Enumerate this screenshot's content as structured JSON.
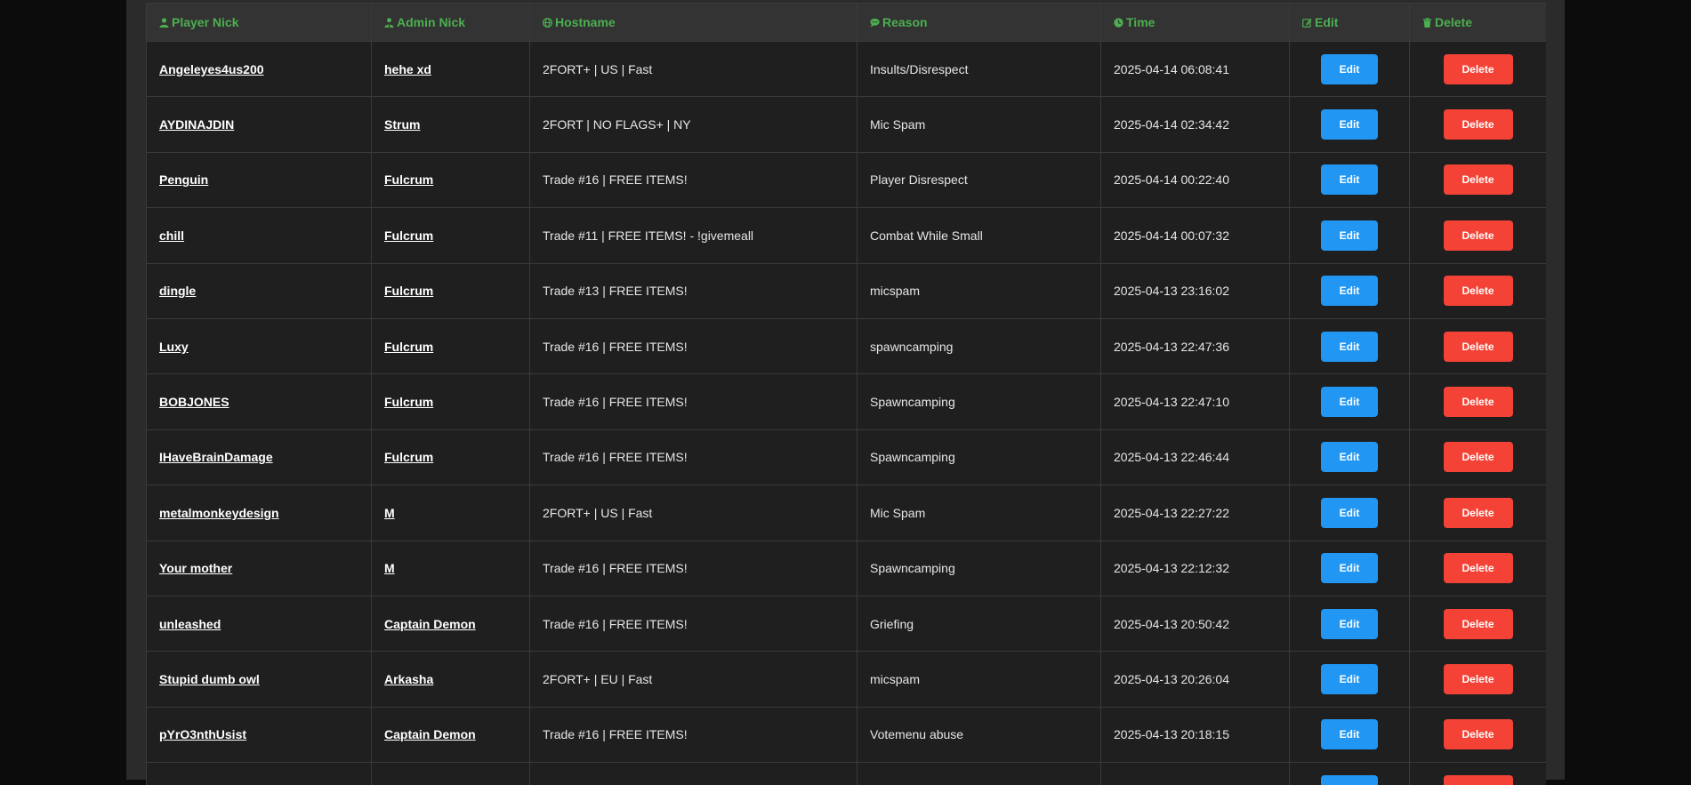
{
  "colors": {
    "header_text": "#4caf50",
    "edit": "#2196f3",
    "delete": "#f44336"
  },
  "headers": {
    "player": {
      "label": "Player Nick",
      "icon": "user-icon"
    },
    "admin": {
      "label": "Admin Nick",
      "icon": "user-tie-icon"
    },
    "hostname": {
      "label": "Hostname",
      "icon": "globe-icon"
    },
    "reason": {
      "label": "Reason",
      "icon": "comment-icon"
    },
    "time": {
      "label": "Time",
      "icon": "clock-icon"
    },
    "edit": {
      "label": "Edit",
      "icon": "edit-icon"
    },
    "delete": {
      "label": "Delete",
      "icon": "trash-icon"
    }
  },
  "rows": [
    {
      "player": "Angeleyes4us200",
      "admin": "hehe xd",
      "hostname": "2FORT+ | US | Fast",
      "reason": "Insults/Disrespect",
      "time": "2025-04-14 06:08:41",
      "edit": "Edit",
      "delete": "Delete"
    },
    {
      "player": "AYDINAJDIN",
      "admin": "Strum",
      "hostname": "2FORT | NO FLAGS+ | NY",
      "reason": "Mic Spam",
      "time": "2025-04-14 02:34:42",
      "edit": "Edit",
      "delete": "Delete"
    },
    {
      "player": "Penguin",
      "admin": "Fulcrum",
      "hostname": "Trade #16 | FREE ITEMS!",
      "reason": "Player Disrespect",
      "time": "2025-04-14 00:22:40",
      "edit": "Edit",
      "delete": "Delete"
    },
    {
      "player": "chill",
      "admin": "Fulcrum",
      "hostname": "Trade #11 | FREE ITEMS! - !givemeall",
      "reason": "Combat While Small",
      "time": "2025-04-14 00:07:32",
      "edit": "Edit",
      "delete": "Delete"
    },
    {
      "player": "dingle",
      "admin": "Fulcrum",
      "hostname": "Trade #13 | FREE ITEMS!",
      "reason": "micspam",
      "time": "2025-04-13 23:16:02",
      "edit": "Edit",
      "delete": "Delete"
    },
    {
      "player": "Luxy",
      "admin": "Fulcrum",
      "hostname": "Trade #16 | FREE ITEMS!",
      "reason": "spawncamping",
      "time": "2025-04-13 22:47:36",
      "edit": "Edit",
      "delete": "Delete"
    },
    {
      "player": "BOBJONES",
      "admin": "Fulcrum",
      "hostname": "Trade #16 | FREE ITEMS!",
      "reason": "Spawncamping",
      "time": "2025-04-13 22:47:10",
      "edit": "Edit",
      "delete": "Delete"
    },
    {
      "player": "IHaveBrainDamage",
      "admin": "Fulcrum",
      "hostname": "Trade #16 | FREE ITEMS!",
      "reason": "Spawncamping",
      "time": "2025-04-13 22:46:44",
      "edit": "Edit",
      "delete": "Delete"
    },
    {
      "player": "metalmonkeydesign",
      "admin": "M",
      "hostname": "2FORT+ | US | Fast",
      "reason": "Mic Spam",
      "time": "2025-04-13 22:27:22",
      "edit": "Edit",
      "delete": "Delete"
    },
    {
      "player": "Your mother",
      "admin": "M",
      "hostname": "Trade #16 | FREE ITEMS!",
      "reason": "Spawncamping",
      "time": "2025-04-13 22:12:32",
      "edit": "Edit",
      "delete": "Delete"
    },
    {
      "player": "unleashed",
      "admin": "Captain Demon",
      "hostname": "Trade #16 | FREE ITEMS!",
      "reason": "Griefing",
      "time": "2025-04-13 20:50:42",
      "edit": "Edit",
      "delete": "Delete"
    },
    {
      "player": "Stupid dumb owl",
      "admin": "Arkasha",
      "hostname": "2FORT+ | EU | Fast",
      "reason": "micspam",
      "time": "2025-04-13 20:26:04",
      "edit": "Edit",
      "delete": "Delete"
    },
    {
      "player": "pYrO3nthUsist",
      "admin": "Captain Demon",
      "hostname": "Trade #16 | FREE ITEMS!",
      "reason": "Votemenu abuse",
      "time": "2025-04-13 20:18:15",
      "edit": "Edit",
      "delete": "Delete"
    },
    {
      "player": "",
      "admin": "",
      "hostname": "",
      "reason": "",
      "time": "",
      "edit": "Edit",
      "delete": "Delete"
    }
  ]
}
